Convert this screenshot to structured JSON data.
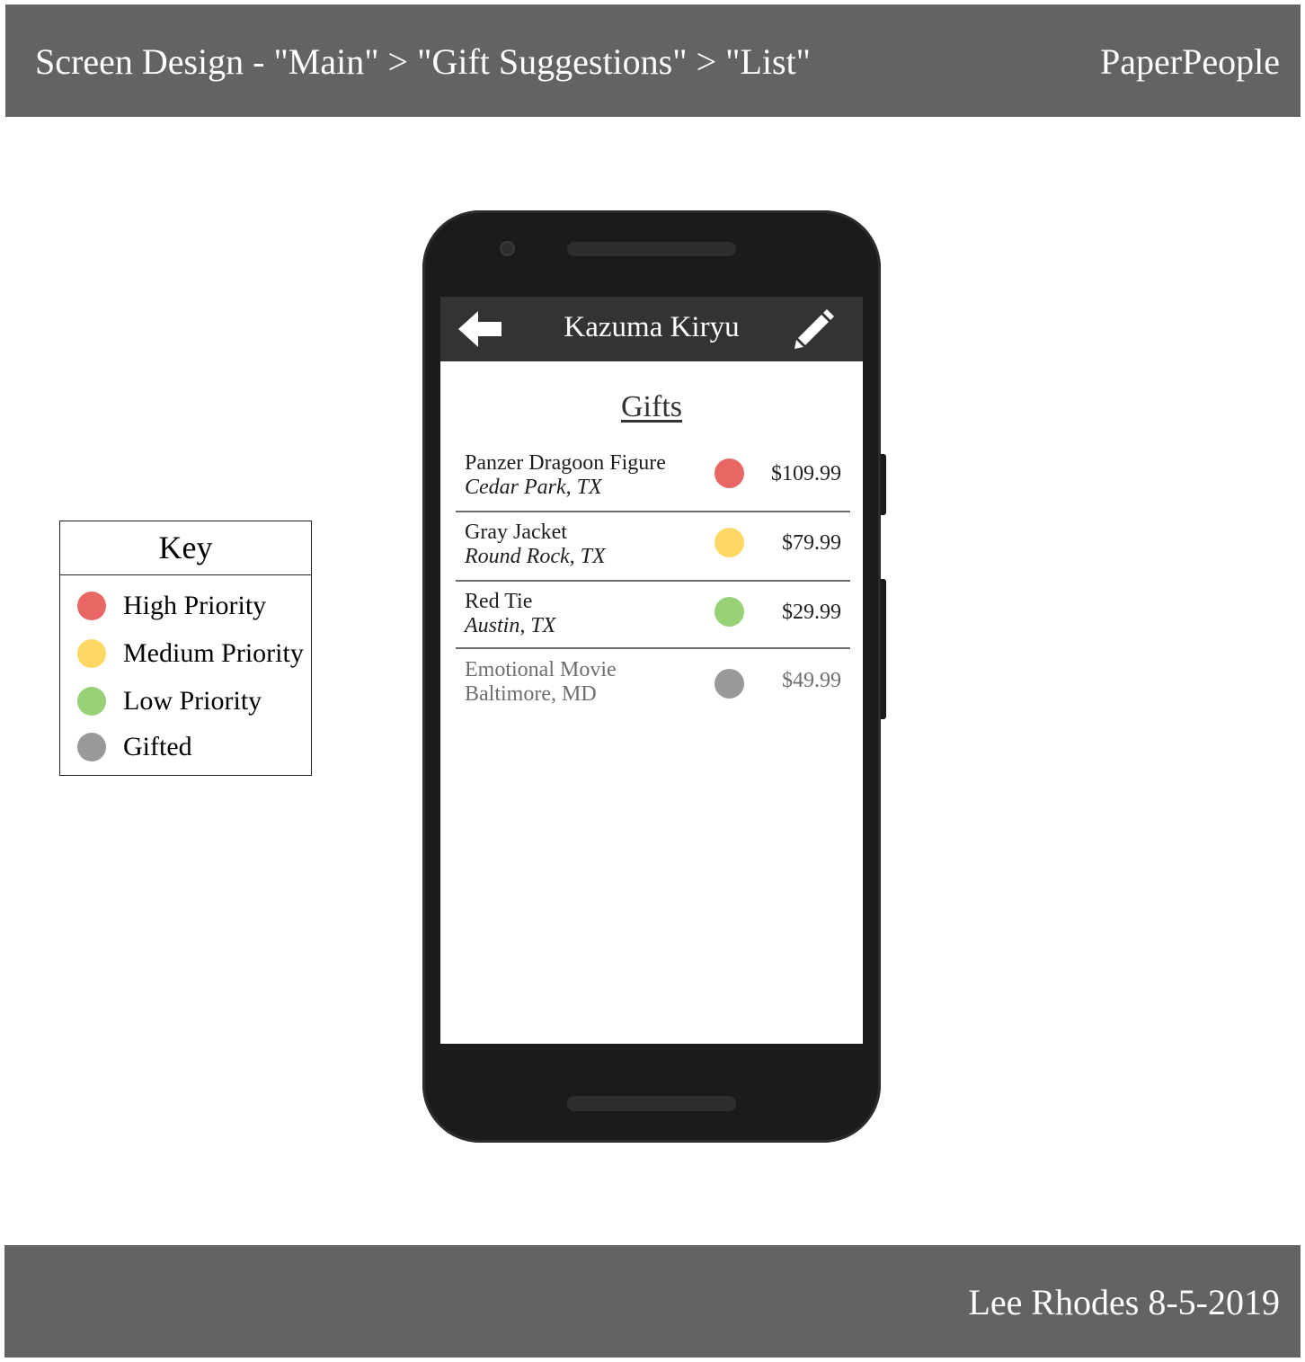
{
  "header": {
    "title": "Screen Design - \"Main\" > \"Gift Suggestions\" > \"List\"",
    "brand": "PaperPeople"
  },
  "footer": {
    "credit": "Lee Rhodes 8-5-2019"
  },
  "key": {
    "title": "Key",
    "items": [
      {
        "label": "High Priority",
        "color": "#e86764"
      },
      {
        "label": "Medium Priority",
        "color": "#fdd964"
      },
      {
        "label": "Low Priority",
        "color": "#97d077"
      },
      {
        "label": "Gifted",
        "color": "#999999"
      }
    ]
  },
  "app": {
    "back_icon": "arrow-left-icon",
    "edit_icon": "pencil-icon",
    "title": "Kazuma Kiryu",
    "section_heading": "Gifts",
    "gifts": [
      {
        "name": "Panzer Dragoon Figure",
        "location": "Cedar Park, TX",
        "price": "$109.99",
        "priority": "High Priority",
        "color": "#e86764"
      },
      {
        "name": "Gray Jacket",
        "location": "Round Rock, TX",
        "price": "$79.99",
        "priority": "Medium Priority",
        "color": "#fdd964"
      },
      {
        "name": "Red Tie",
        "location": "Austin, TX",
        "price": "$29.99",
        "priority": "Low Priority",
        "color": "#97d077"
      },
      {
        "name": "Emotional Movie",
        "location": "Baltimore, MD",
        "price": "$49.99",
        "priority": "Gifted",
        "color": "#999999"
      }
    ]
  }
}
